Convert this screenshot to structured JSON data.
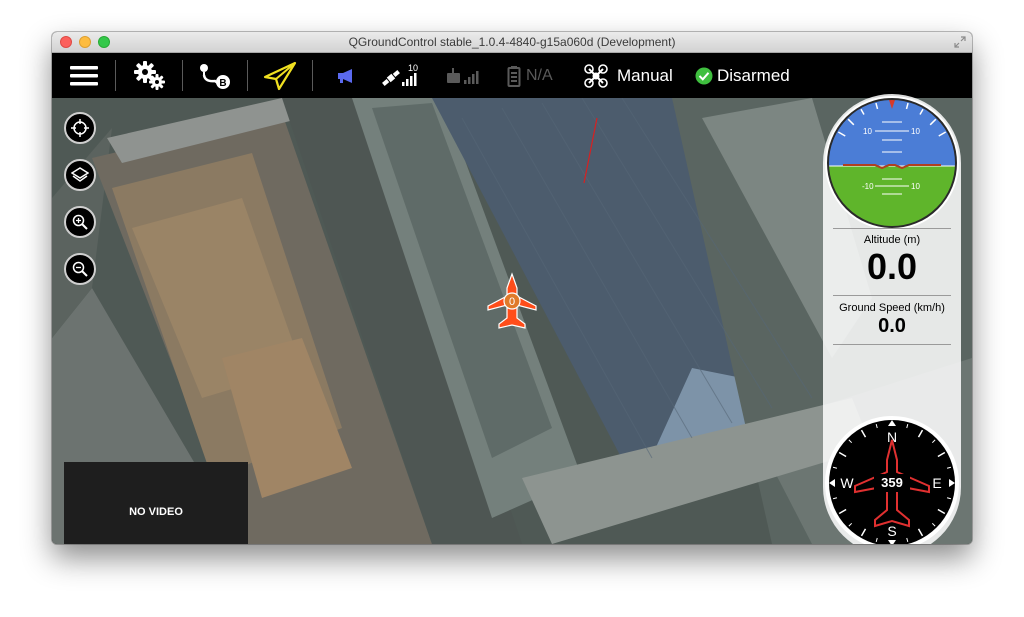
{
  "window": {
    "title": "QGroundControl stable_1.0.4-4840-g15a060d (Development)"
  },
  "toolbar": {
    "gps_count": "10",
    "battery": "N/A",
    "flight_mode": "Manual",
    "arm_status": "Disarmed"
  },
  "video": {
    "status": "NO VIDEO"
  },
  "vehicle": {
    "id": "0"
  },
  "instruments": {
    "attitude": {
      "pitch_labels": [
        "10",
        "10",
        "-10",
        "10"
      ]
    },
    "altitude": {
      "label": "Altitude (m)",
      "value": "0.0"
    },
    "ground_speed": {
      "label": "Ground Speed (km/h)",
      "value": "0.0"
    },
    "compass": {
      "heading": "359",
      "north": "N",
      "south": "S",
      "east": "E",
      "west": "W"
    }
  },
  "colors": {
    "sky": "#4b7dd6",
    "ground": "#5fb52b",
    "vehicle": "#ff4d1a",
    "megaphone": "#5b6af0",
    "send_icon": "#f0e020",
    "armed_ok": "#3fbf3f"
  }
}
